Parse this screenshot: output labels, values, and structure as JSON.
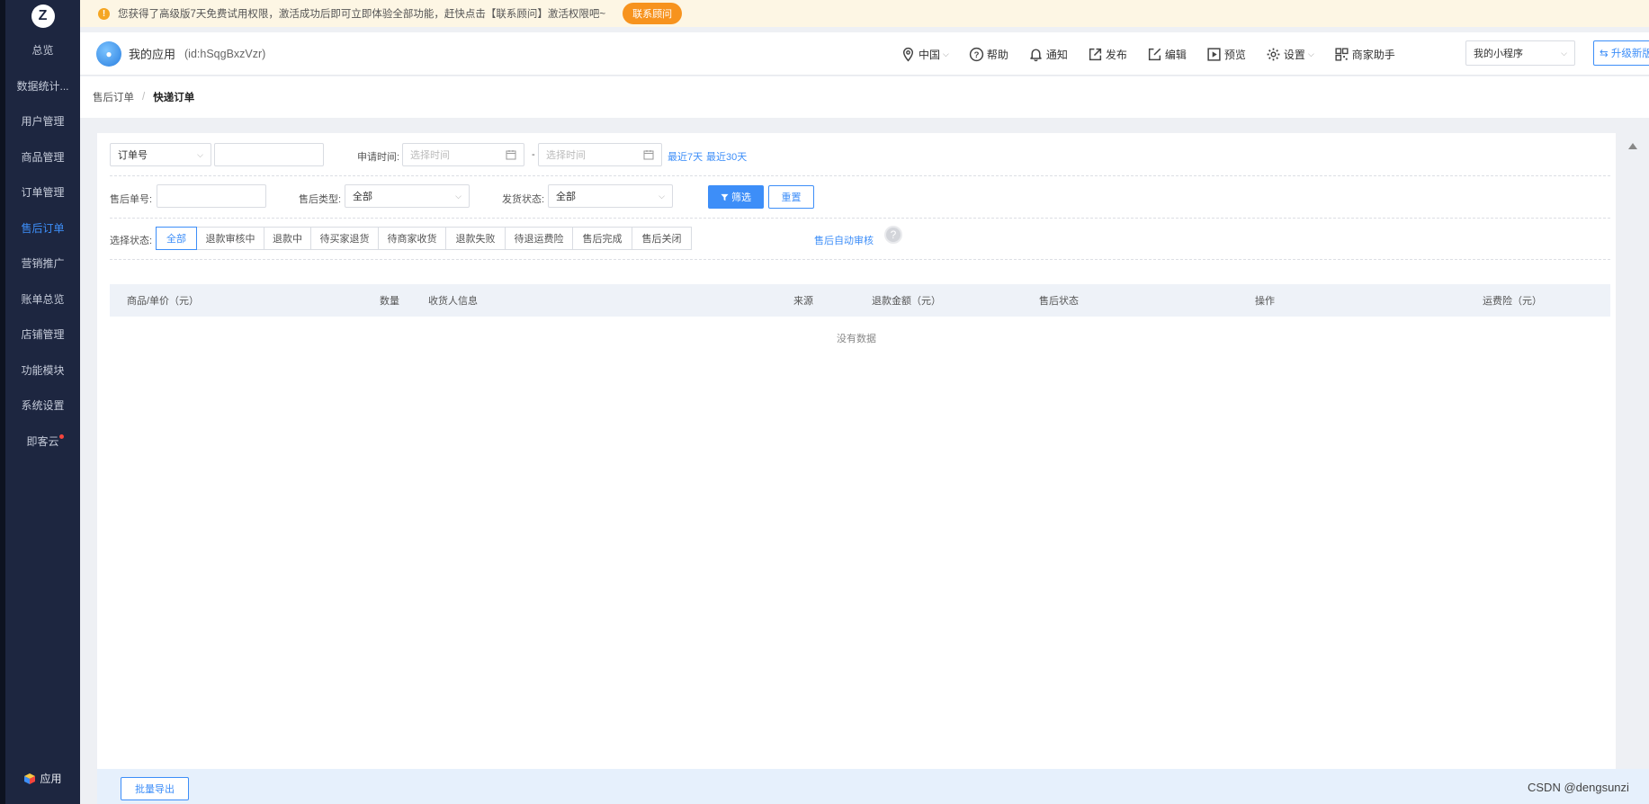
{
  "notice": {
    "text": "您获得了高级版7天免费试用权限，激活成功后即可立即体验全部功能，赶快点击【联系顾问】激活权限吧~",
    "button": "联系顾问"
  },
  "sidebar": {
    "items": [
      {
        "label": "总览"
      },
      {
        "label": "数据统计..."
      },
      {
        "label": "用户管理"
      },
      {
        "label": "商品管理"
      },
      {
        "label": "订单管理"
      },
      {
        "label": "售后订单"
      },
      {
        "label": "营销推广"
      },
      {
        "label": "账单总览"
      },
      {
        "label": "店铺管理"
      },
      {
        "label": "功能模块"
      },
      {
        "label": "系统设置"
      },
      {
        "label": "即客云"
      }
    ],
    "active_index": 5,
    "apps_label": "应用"
  },
  "header": {
    "app_name": "我的应用",
    "app_id": "(id:hSqgBxzVzr)",
    "nav": {
      "region": "中国",
      "help": "帮助",
      "notify": "通知",
      "publish": "发布",
      "edit": "编辑",
      "preview": "预览",
      "settings": "设置",
      "assistant": "商家助手"
    },
    "mini_program": "我的小程序",
    "upgrade": "升级新版"
  },
  "breadcrumb": {
    "parent": "售后订单",
    "separator": "/",
    "current": "快递订单"
  },
  "filters": {
    "order_type": "订单号",
    "order_value": "",
    "apply_time_label": "申请时间:",
    "start_placeholder": "选择时间",
    "range_sep": "-",
    "end_placeholder": "选择时间",
    "last7": "最近7天",
    "last30": "最近30天",
    "after_sale_no_label": "售后单号:",
    "after_sale_no_value": "",
    "after_sale_type_label": "售后类型:",
    "after_sale_type_value": "全部",
    "ship_status_label": "发货状态:",
    "ship_status_value": "全部",
    "filter_button": "筛选",
    "reset_button": "重置",
    "status_label": "选择状态:",
    "statuses": [
      "全部",
      "退款审核中",
      "退款中",
      "待买家退货",
      "待商家收货",
      "退款失败",
      "待退运费险",
      "售后完成",
      "售后关闭"
    ],
    "active_status": 0,
    "auto_review": "售后自动审核"
  },
  "table": {
    "columns": [
      "商品/单价（元）",
      "数量",
      "收货人信息",
      "来源",
      "退款金额（元）",
      "售后状态",
      "操作",
      "运费险（元）"
    ],
    "empty_text": "没有数据"
  },
  "footer": {
    "export": "批量导出"
  },
  "watermark": "CSDN @dengsunzi",
  "colors": {
    "sidebar_bg": "#1d2640",
    "primary": "#3d8ef8",
    "notice_bg": "#fdf6e4",
    "notice_button": "#f7931e"
  }
}
